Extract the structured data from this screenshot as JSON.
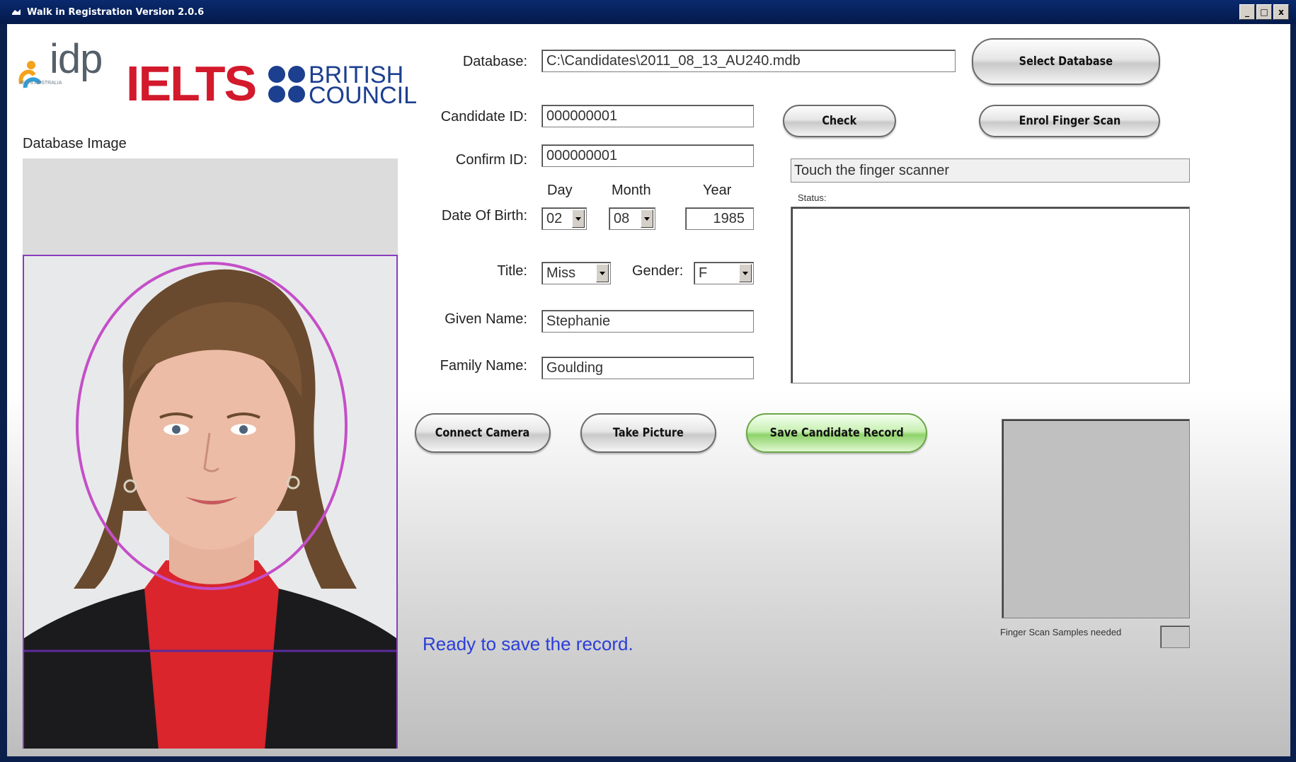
{
  "window": {
    "title": "Walk in Registration  Version 2.0.6",
    "controls": [
      "_",
      "□",
      "x"
    ]
  },
  "logos": {
    "idp": "idp",
    "idp_subtitle": "IELTS AUSTRALIA",
    "ielts": "IELTS",
    "british_council_line1": "BRITISH",
    "british_council_line2": "COUNCIL"
  },
  "photo": {
    "label": "Database Image"
  },
  "form": {
    "database_label": "Database:",
    "database_value": "C:\\Candidates\\2011_08_13_AU240.mdb",
    "candidate_id_label": "Candidate ID:",
    "candidate_id_value": "000000001",
    "confirm_id_label": "Confirm ID:",
    "confirm_id_value": "000000001",
    "dob_label": "Date Of Birth:",
    "day_label": "Day",
    "month_label": "Month",
    "year_label": "Year",
    "day_value": "02",
    "month_value": "08",
    "year_value": "1985",
    "title_label": "Title:",
    "title_value": "Miss",
    "gender_label": "Gender:",
    "gender_value": "F",
    "given_name_label": "Given Name:",
    "given_name_value": "Stephanie",
    "family_name_label": "Family Name:",
    "family_name_value": "Goulding"
  },
  "buttons": {
    "select_database": "Select Database",
    "check": "Check",
    "enrol_finger_scan": "Enrol Finger Scan",
    "connect_camera": "Connect Camera",
    "take_picture": "Take Picture",
    "save_candidate_record": "Save Candidate Record"
  },
  "scanner": {
    "message": "Touch the finger scanner",
    "status_label": "Status:",
    "status_text": "",
    "samples_label": "Finger Scan Samples needed",
    "samples_value": ""
  },
  "footer_message": "Ready to save the record.",
  "colors": {
    "title_bar": "#06205a",
    "ielts_red": "#d3192c",
    "british_council_blue": "#1c3f8f",
    "ready_message": "#2a3ed8",
    "save_button_green": "#8fd36a",
    "photo_guide": "#c44fc7"
  }
}
